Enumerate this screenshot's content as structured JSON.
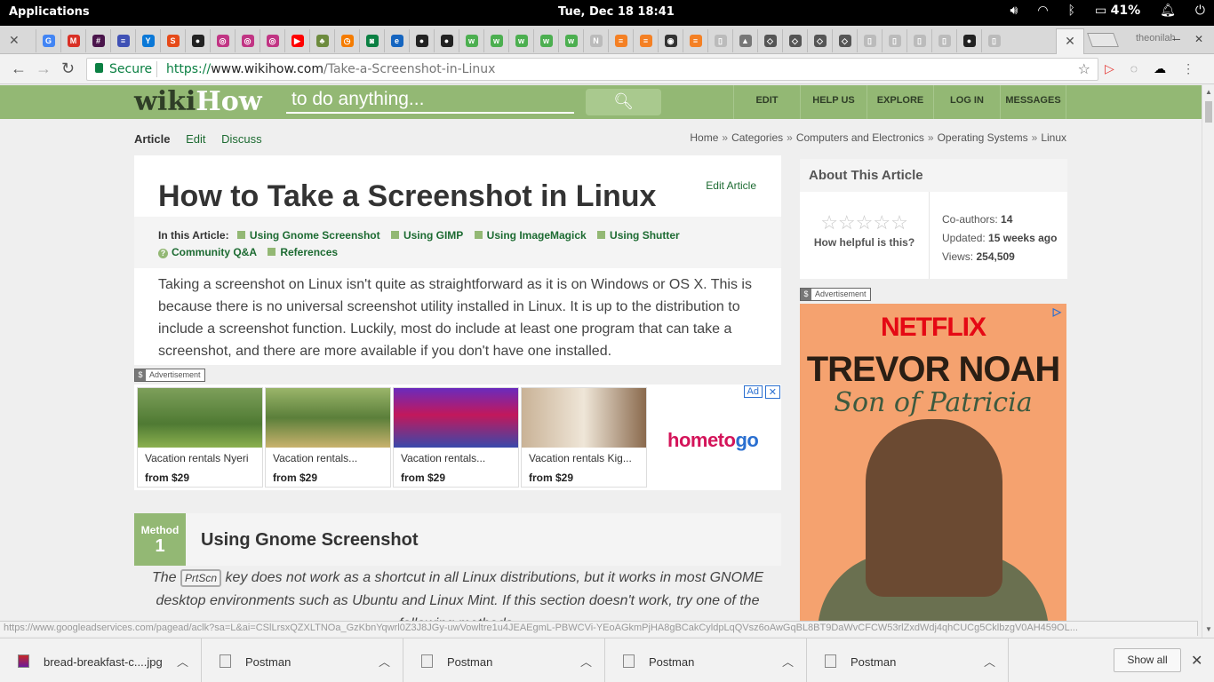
{
  "system": {
    "apps_label": "Applications",
    "clock": "Tue, Dec 18   18:41",
    "battery": "41%",
    "tray_icons": [
      "volume-icon",
      "wifi-icon",
      "bluetooth-icon",
      "battery-icon",
      "bell-icon",
      "power-icon"
    ]
  },
  "browser": {
    "profile": "theonilah",
    "omnibox": {
      "secure_label": "Secure",
      "url_scheme": "https://",
      "url_host": "www.wikihow.com",
      "url_path": "/Take-a-Screenshot-in-Linux"
    },
    "status_url": "https://www.googleadservices.com/pagead/aclk?sa=L&ai=CSlLrsxQZXLTNOa_GzKbnYqwrl0Z3J8JGy-uwVowltre1u4JEAEgmL-PBWCVi-YEoAGkmPjHA8gBCakCyldpLqQVsz6oAwGqBL8BT9DaWvCFCW53rlZxdWdj4qhCUCg5CklbzgV0AH459OL..."
  },
  "wikihow": {
    "logo_part1": "wiki",
    "logo_part2": "How",
    "search_placeholder": "to do anything...",
    "nav": [
      "EDIT",
      "HELP US",
      "EXPLORE",
      "LOG IN",
      "MESSAGES"
    ],
    "subnav": [
      "Article",
      "Edit",
      "Discuss"
    ],
    "breadcrumbs": [
      "Home",
      "Categories",
      "Computers and Electronics",
      "Operating Systems",
      "Linux"
    ],
    "edit_article": "Edit Article",
    "title": "How to Take a Screenshot in Linux",
    "toc_label": "In this Article:",
    "toc": [
      "Using Gnome Screenshot",
      "Using GIMP",
      "Using ImageMagick",
      "Using Shutter",
      "Community Q&A",
      "References"
    ],
    "intro": "Taking a screenshot on Linux isn't quite as straightforward as it is on Windows or OS X. This is because there is no universal screenshot utility installed in Linux. It is up to the distribution to include a screenshot function. Luckily, most do include at least one program that can take a screenshot, and there are more available if you don't have one installed.",
    "ad_label": "Advertisement",
    "ads": [
      {
        "title": "Vacation rentals Nyeri",
        "price": "from $29"
      },
      {
        "title": "Vacation rentals...",
        "price": "from $29"
      },
      {
        "title": "Vacation rentals...",
        "price": "from $29"
      },
      {
        "title": "Vacation rentals Kig...",
        "price": "from $29"
      }
    ],
    "ad_brand_1": "hometo",
    "ad_brand_2": "go",
    "ad_tag": "Ad",
    "method_label": "Method",
    "method_number": "1",
    "method_title": "Using Gnome Screenshot",
    "tip_before": "The ",
    "tip_key": "PrtScn",
    "tip_after": " key does not work as a shortcut in all Linux distributions, but it works in most GNOME desktop environments such as Ubuntu and Linux Mint. If this section doesn't work, try one of the following methods.",
    "about": {
      "heading": "About This Article",
      "stars": "☆☆☆☆☆",
      "helpful": "How helpful is this?",
      "coauthors_label": "Co-authors: ",
      "coauthors": "14",
      "updated_label": "Updated: ",
      "updated": "15 weeks ago",
      "views_label": "Views: ",
      "views": "254,509"
    },
    "side_ad": {
      "brand": "NETFLIX",
      "title": "TREVOR NOAH",
      "subtitle": "Son of Patricia"
    }
  },
  "downloads": {
    "items": [
      "bread-breakfast-c....jpg",
      "Postman",
      "Postman",
      "Postman",
      "Postman"
    ],
    "show_all": "Show all"
  }
}
